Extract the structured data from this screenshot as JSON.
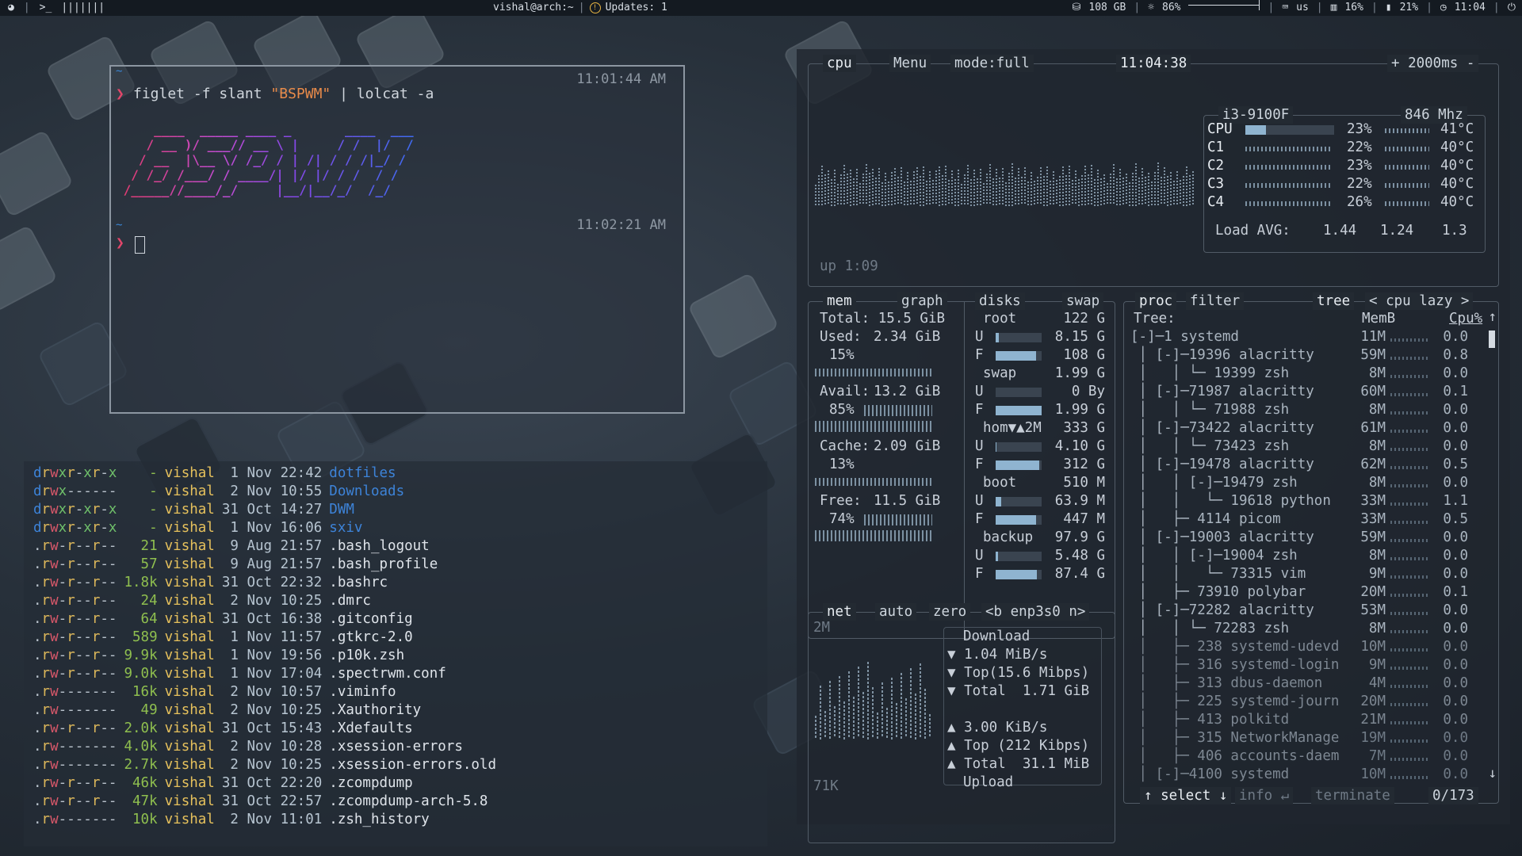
{
  "topbar": {
    "title": "vishal@arch:~",
    "updates": "Updates: 1",
    "workspaces": "|||||||",
    "disk": "108 GB",
    "brightness": "86%",
    "keyboard": "us",
    "ram": "16%",
    "battery": "21%",
    "clock": "11:04",
    "volume_level": 0.8,
    "icons": [
      "arch-logo-icon",
      "terminal-icon",
      "disk-icon",
      "brightness-icon",
      "keyboard-icon",
      "ram-icon",
      "battery-icon",
      "clock-icon",
      "power-icon"
    ]
  },
  "terminal": {
    "tilde": "~",
    "time1": "11:01:44 AM",
    "cmd_prefix": "figlet -f slant ",
    "cmd_string": "\"BSPWM\"",
    "cmd_suffix": " | lolcat -a",
    "figlet": "     ____  _____ ____ _       ____  ___\n    / __ )/ ___// __ \\ |     / /  |/  /\n   / __  |\\__ \\/ /_/ / | /| / / /|_/ / \n  / /_/ /___/ / ____/| |/ |/ / /  / /  \n /_____//____/_/     |__/|__/_/  /_/   ",
    "time2": "11:02:21 AM"
  },
  "ls": {
    "rows": [
      {
        "perm": "drwxr-xr-x",
        "size": "-",
        "user": "vishal",
        "date": " 1 Nov 22:42",
        "name": "dotfiles",
        "dir": true
      },
      {
        "perm": "drwx------",
        "size": "-",
        "user": "vishal",
        "date": " 2 Nov 10:55",
        "name": "Downloads",
        "dir": true
      },
      {
        "perm": "drwxr-xr-x",
        "size": "-",
        "user": "vishal",
        "date": "31 Oct 14:27",
        "name": "DWM",
        "dir": true
      },
      {
        "perm": "drwxr-xr-x",
        "size": "-",
        "user": "vishal",
        "date": " 1 Nov 16:06",
        "name": "sxiv",
        "dir": true
      },
      {
        "perm": ".rw-r--r--",
        "size": "21",
        "user": "vishal",
        "date": " 9 Aug 21:57",
        "name": ".bash_logout",
        "dir": false
      },
      {
        "perm": ".rw-r--r--",
        "size": "57",
        "user": "vishal",
        "date": " 9 Aug 21:57",
        "name": ".bash_profile",
        "dir": false
      },
      {
        "perm": ".rw-r--r--",
        "size": "1.8k",
        "user": "vishal",
        "date": "31 Oct 22:32",
        "name": ".bashrc",
        "dir": false
      },
      {
        "perm": ".rw-r--r--",
        "size": "24",
        "user": "vishal",
        "date": " 2 Nov 10:25",
        "name": ".dmrc",
        "dir": false
      },
      {
        "perm": ".rw-r--r--",
        "size": "64",
        "user": "vishal",
        "date": "31 Oct 16:38",
        "name": ".gitconfig",
        "dir": false
      },
      {
        "perm": ".rw-r--r--",
        "size": "589",
        "user": "vishal",
        "date": " 1 Nov 11:57",
        "name": ".gtkrc-2.0",
        "dir": false
      },
      {
        "perm": ".rw-r--r--",
        "size": "9.9k",
        "user": "vishal",
        "date": " 1 Nov 19:56",
        "name": ".p10k.zsh",
        "dir": false
      },
      {
        "perm": ".rw-r--r--",
        "size": "9.0k",
        "user": "vishal",
        "date": " 1 Nov 17:04",
        "name": ".spectrwm.conf",
        "dir": false
      },
      {
        "perm": ".rw-------",
        "size": "16k",
        "user": "vishal",
        "date": " 2 Nov 10:57",
        "name": ".viminfo",
        "dir": false
      },
      {
        "perm": ".rw-------",
        "size": "49",
        "user": "vishal",
        "date": " 2 Nov 10:25",
        "name": ".Xauthority",
        "dir": false
      },
      {
        "perm": ".rw-r--r--",
        "size": "2.0k",
        "user": "vishal",
        "date": "31 Oct 15:43",
        "name": ".Xdefaults",
        "dir": false
      },
      {
        "perm": ".rw-------",
        "size": "4.0k",
        "user": "vishal",
        "date": " 2 Nov 10:28",
        "name": ".xsession-errors",
        "dir": false
      },
      {
        "perm": ".rw-------",
        "size": "2.7k",
        "user": "vishal",
        "date": " 2 Nov 10:25",
        "name": ".xsession-errors.old",
        "dir": false
      },
      {
        "perm": ".rw-r--r--",
        "size": "46k",
        "user": "vishal",
        "date": "31 Oct 22:20",
        "name": ".zcompdump",
        "dir": false
      },
      {
        "perm": ".rw-r--r--",
        "size": "47k",
        "user": "vishal",
        "date": "31 Oct 22:57",
        "name": ".zcompdump-arch-5.8",
        "dir": false
      },
      {
        "perm": ".rw-------",
        "size": "10k",
        "user": "vishal",
        "date": " 2 Nov 11:01",
        "name": ".zsh_history",
        "dir": false
      }
    ]
  },
  "btop": {
    "cpu_box": {
      "title": "cpu",
      "menu": "Menu",
      "mode": "mode:full",
      "time": "11:04:38",
      "rate": "+ 2000ms -",
      "uptime": "up 1:09",
      "model": "i3-9100F",
      "freq": "846 Mhz",
      "rows": [
        {
          "name": "CPU",
          "pct": "23%",
          "temp": "41°C",
          "level": 0.23,
          "bar": true
        },
        {
          "name": "C1",
          "pct": "22%",
          "temp": "40°C",
          "level": 0.22,
          "bar": false
        },
        {
          "name": "C2",
          "pct": "23%",
          "temp": "40°C",
          "level": 0.23,
          "bar": false
        },
        {
          "name": "C3",
          "pct": "22%",
          "temp": "40°C",
          "level": 0.22,
          "bar": false
        },
        {
          "name": "C4",
          "pct": "26%",
          "temp": "40°C",
          "level": 0.26,
          "bar": false
        }
      ],
      "load_label": "Load AVG:",
      "load": [
        "1.44",
        "1.24",
        "1.3"
      ]
    },
    "mem_box": {
      "title": "mem",
      "graph": "graph",
      "total": "Total: 15.5 GiB",
      "used": "Used:",
      "used_val": "2.34 GiB",
      "used_pct": "15%",
      "avail": "Avail:",
      "avail_val": "13.2 GiB",
      "avail_pct": "85%",
      "cache": "Cache:",
      "cache_val": "2.09 GiB",
      "cache_pct": "13%",
      "free": "Free:",
      "free_val": "11.5 GiB",
      "free_pct": "74%"
    },
    "disks_box": {
      "title": "disks",
      "swap": "swap",
      "items": [
        {
          "name": "root",
          "total": "122 G",
          "u": "8.15 G",
          "f": "108 G",
          "u_level": 0.07,
          "f_level": 0.88
        },
        {
          "name": "swap",
          "total": "1.99 G",
          "u": "0 By",
          "f": "1.99 G",
          "u_level": 0.0,
          "f_level": 1.0
        },
        {
          "name": "hom▼▲2M",
          "total": "333 G",
          "u": "4.10 G",
          "f": "312 G",
          "u_level": 0.01,
          "f_level": 0.94
        },
        {
          "name": "boot",
          "total": "510 M",
          "u": "63.9 M",
          "f": "447 M",
          "u_level": 0.12,
          "f_level": 0.88
        },
        {
          "name": "backup",
          "total": "97.9 G",
          "u": "5.48 G",
          "f": "87.4 G",
          "u_level": 0.06,
          "f_level": 0.89
        }
      ]
    },
    "net_box": {
      "title": "net",
      "auto": "auto",
      "zero": "zero",
      "iface": "<b enp3s0 n>",
      "scale_top": "2M",
      "scale_bottom": "71K",
      "download": "Download",
      "dl_rate": "▼ 1.04 MiB/s",
      "dl_top": "▼ Top(15.6 Mibps)",
      "dl_total": "▼ Total  1.71 GiB",
      "ul_rate": "▲ 3.00 KiB/s",
      "ul_top": "▲ Top (212 Kibps)",
      "ul_total": "▲ Total  31.1 MiB",
      "upload": "Upload"
    },
    "proc_box": {
      "title": "proc",
      "filter": "filter",
      "tree": "tree",
      "sort": "< cpu lazy >",
      "col_tree": "Tree:",
      "col_mem": "MemB",
      "col_cpu": "Cpu%",
      "rows": [
        {
          "tree": "[-]─1 systemd",
          "mem": "11M",
          "cpu": "0.0",
          "dot": true
        },
        {
          "tree": " │ [-]─19396 alacritty",
          "mem": "59M",
          "cpu": "0.8",
          "dot": true
        },
        {
          "tree": " │   │ └─ 19399 zsh",
          "mem": "8M",
          "cpu": "0.0",
          "dot": true
        },
        {
          "tree": " │ [-]─71987 alacritty",
          "mem": "60M",
          "cpu": "0.1",
          "dot": true
        },
        {
          "tree": " │   │ └─ 71988 zsh",
          "mem": "8M",
          "cpu": "0.0",
          "dot": true
        },
        {
          "tree": " │ [-]─73422 alacritty",
          "mem": "61M",
          "cpu": "0.0",
          "dot": true
        },
        {
          "tree": " │   │ └─ 73423 zsh",
          "mem": "8M",
          "cpu": "0.0",
          "dot": true
        },
        {
          "tree": " │ [-]─19478 alacritty",
          "mem": "62M",
          "cpu": "0.5",
          "dot": true
        },
        {
          "tree": " │   │ [-]─19479 zsh",
          "mem": "8M",
          "cpu": "0.0",
          "dot": true
        },
        {
          "tree": " │   │   └─ 19618 python",
          "mem": "33M",
          "cpu": "1.1",
          "dot": true
        },
        {
          "tree": " │   ├─ 4114 picom",
          "mem": "33M",
          "cpu": "0.5",
          "dot": true
        },
        {
          "tree": " │ [-]─19003 alacritty",
          "mem": "59M",
          "cpu": "0.0",
          "dot": true
        },
        {
          "tree": " │   │ [-]─19004 zsh",
          "mem": "8M",
          "cpu": "0.0",
          "dot": true
        },
        {
          "tree": " │   │   └─ 73315 vim",
          "mem": "9M",
          "cpu": "0.0",
          "dot": true
        },
        {
          "tree": " │   ├─ 73910 polybar",
          "mem": "20M",
          "cpu": "0.1",
          "dot": true
        },
        {
          "tree": " │ [-]─72282 alacritty",
          "mem": "53M",
          "cpu": "0.0",
          "dot": true
        },
        {
          "tree": " │   │ └─ 72283 zsh",
          "mem": "8M",
          "cpu": "0.0",
          "dot": true
        },
        {
          "tree": " │   ├─ 238 systemd-udevd",
          "mem": "10M",
          "cpu": "0.0",
          "dot": true
        },
        {
          "tree": " │   ├─ 316 systemd-login",
          "mem": "9M",
          "cpu": "0.0",
          "dot": true
        },
        {
          "tree": " │   ├─ 313 dbus-daemon",
          "mem": "4M",
          "cpu": "0.0",
          "dot": true
        },
        {
          "tree": " │   ├─ 225 systemd-journ",
          "mem": "20M",
          "cpu": "0.0",
          "dot": true
        },
        {
          "tree": " │   ├─ 413 polkitd",
          "mem": "21M",
          "cpu": "0.0",
          "dot": true
        },
        {
          "tree": " │   ├─ 315 NetworkManage",
          "mem": "19M",
          "cpu": "0.0",
          "dot": true
        },
        {
          "tree": " │   ├─ 406 accounts-daem",
          "mem": "7M",
          "cpu": "0.0",
          "dot": true
        },
        {
          "tree": " │ [-]─4100 systemd",
          "mem": "10M",
          "cpu": "0.0",
          "dot": true
        }
      ],
      "footer_select": "↑ select ↓",
      "footer_info": "info ↵",
      "footer_term": "terminate",
      "footer_count": "0/173"
    }
  }
}
